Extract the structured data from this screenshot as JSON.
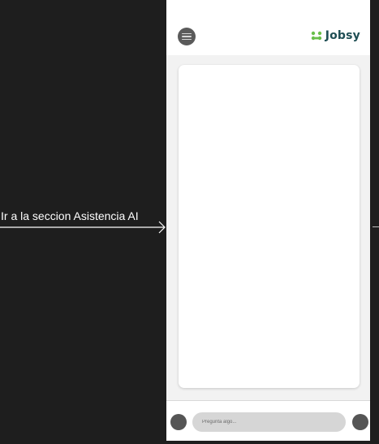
{
  "flow": {
    "label": "Ir a la seccion Asistencia AI"
  },
  "header": {
    "brand_name": "Jobsy",
    "brand_color": "#1f4e54",
    "logo_color": "#6abf4b",
    "menu_icon": "hamburger-menu-icon"
  },
  "chat": {
    "background": "#f2f2f2",
    "card_background": "#ffffff"
  },
  "input_bar": {
    "placeholder": "Pregunta algo...",
    "left_icon": "attach-icon",
    "right_icon": "send-icon"
  }
}
